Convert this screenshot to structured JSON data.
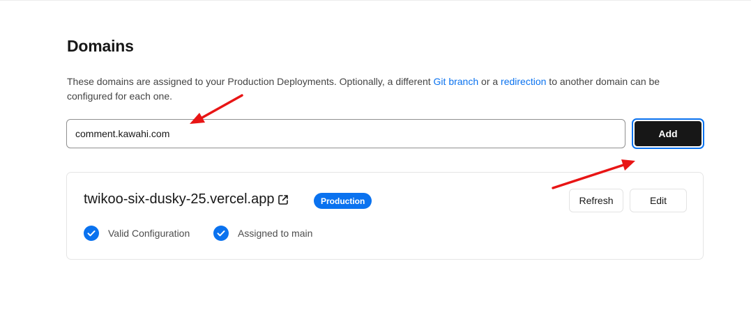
{
  "section": {
    "title": "Domains",
    "desc_prefix": "These domains are assigned to your Production Deployments. Optionally, a different ",
    "link_git_branch": "Git branch",
    "desc_middle": " or a ",
    "link_redirection": "redirection",
    "desc_suffix": " to another domain can be configured for each one."
  },
  "input": {
    "value": "comment.kawahi.com"
  },
  "add_button": {
    "label": "Add"
  },
  "domain_card": {
    "domain": "twikoo-six-dusky-25.vercel.app",
    "badge": "Production",
    "refresh_label": "Refresh",
    "edit_label": "Edit",
    "checks": [
      {
        "label": "Valid Configuration"
      },
      {
        "label": "Assigned to main"
      }
    ]
  },
  "colors": {
    "accent": "#0a72ef",
    "button_dark": "#171717",
    "annotation_arrow": "#e81515"
  }
}
